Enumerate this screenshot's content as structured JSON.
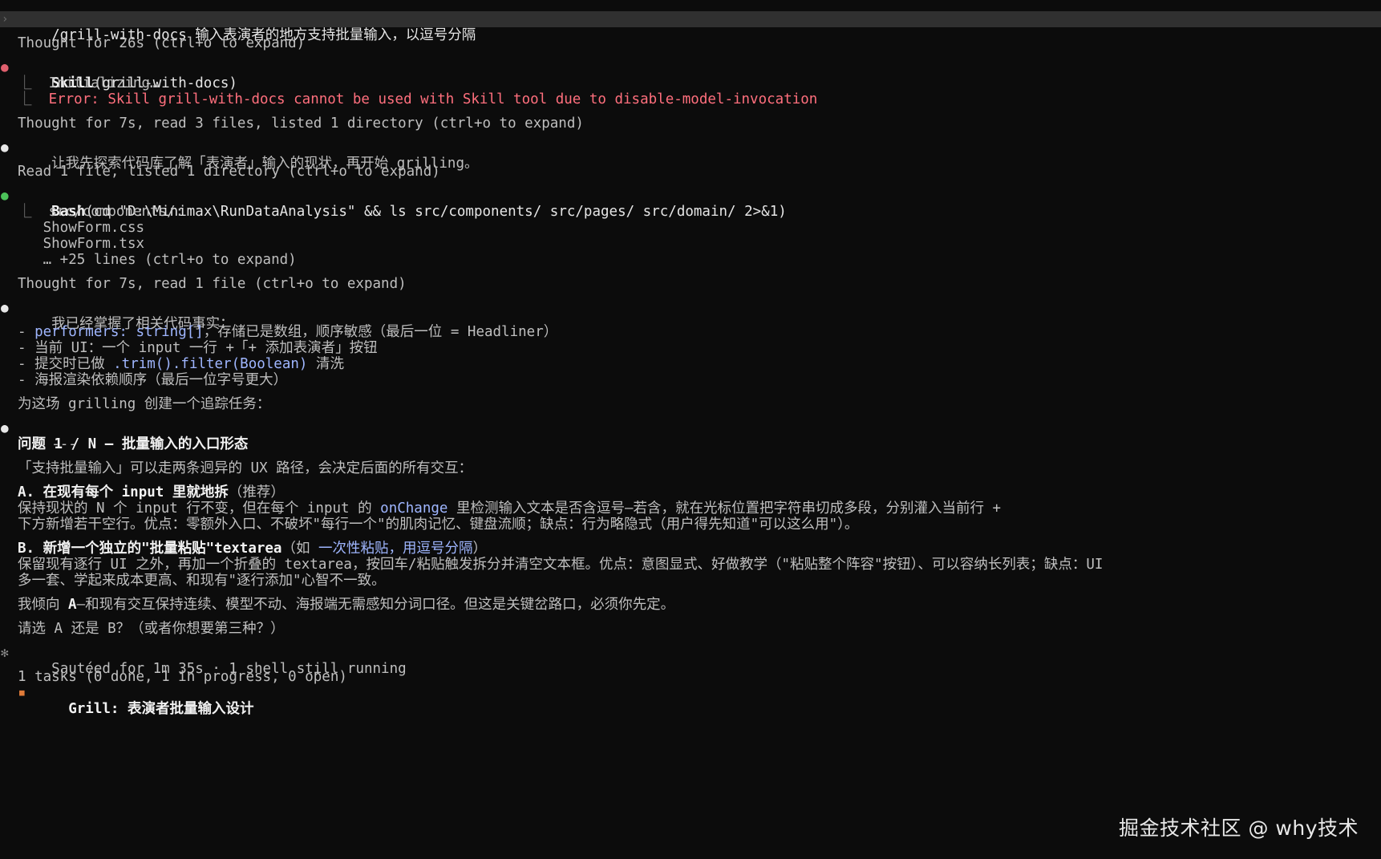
{
  "command": {
    "text": "/grill-with-docs 输入表演者的地方支持批量输入，以逗号分隔"
  },
  "thought1": "Thought for 26s (ctrl+o to expand)",
  "skill": {
    "name": "Skill",
    "args": "(grill-with-docs)",
    "initializing": "Initializing…",
    "error": "Error: Skill grill-with-docs cannot be used with Skill tool due to disable-model-invocation"
  },
  "thought2": "Thought for 7s, read 3 files, listed 1 directory (ctrl+o to expand)",
  "explore_msg": "让我先探索代码库了解「表演者」输入的现状，再开始 grilling。",
  "read1": "Read 1 file, listed 1 directory (ctrl+o to expand)",
  "bash": {
    "name": "Bash",
    "args": "(cd \"D:\\Minimax\\RunDataAnalysis\" && ls src/components/ src/pages/ src/domain/ 2>&1)",
    "output": [
      "src/components/:",
      "ShowForm.css",
      "ShowForm.tsx",
      "… +25 lines (ctrl+o to expand)"
    ]
  },
  "thought3": "Thought for 7s, read 1 file (ctrl+o to expand)",
  "facts_intro": "我已经掌握了相关代码事实：",
  "facts": {
    "f1_code": "performers: string[]",
    "f1_text": "，存储已是数组，顺序敏感（最后一位 = Headliner）",
    "f2_text": "当前 UI：一个 input 一行 +「+ 添加表演者」按钮",
    "f3_pre": "提交时已做 ",
    "f3_code": ".trim().filter(Boolean)",
    "f3_post": " 清洗",
    "f4_text": "海报渲染依赖顺序（最后一位字号更大）"
  },
  "track_msg": "为这场 grilling 创建一个追踪任务：",
  "separator": "---",
  "question_title": "问题 1 / N — 批量输入的入口形态",
  "question_intro": "「支持批量输入」可以走两条迥异的 UX 路径，会决定后面的所有交互：",
  "option_a": {
    "title": "A. 在现有每个 input 里就地拆",
    "note": "（推荐）",
    "line1_pre": "保持现状的 N 个 input 行不变，但在每个 input 的 ",
    "line1_code": "onChange",
    "line1_post": " 里检测输入文本是否含逗号—若含，就在光标位置把字符串切成多段，分别灌入当前行 +",
    "line2": "下方新增若干空行。优点：零额外入口、不破坏\"每行一个\"的肌肉记忆、键盘流顺；缺点：行为略隐式（用户得先知道\"可以这么用\"）。"
  },
  "option_b": {
    "title": "B. 新增一个独立的\"批量粘贴\"textarea",
    "note_pre": "（如 ",
    "note_hl": "一次性粘贴，用逗号分隔",
    "note_post": "）",
    "line1": "保留现有逐行 UI 之外，再加一个折叠的 textarea，按回车/粘贴触发拆分并清空文本框。优点：意图显式、好做教学（\"粘贴整个阵容\"按钮）、可以容纳长列表；缺点：UI",
    "line2": "多一套、学起来成本更高、和现有\"逐行添加\"心智不一致。"
  },
  "lean_pre": "我倾向 ",
  "lean_a": "A",
  "lean_post": "—和现有交互保持连续、模型不动、海报端无需感知分词口径。但这是关键岔路口，必须你先定。",
  "ask": "请选 A 还是 B？（或者你想要第三种？）",
  "status": "Sautéed for 1m 35s · 1 shell still running",
  "tasks_summary": "1 tasks (0 done, 1 in progress, 0 open)",
  "task_item": "Grill: 表演者批量输入设计",
  "watermark": "掘金技术社区 @ why技术"
}
